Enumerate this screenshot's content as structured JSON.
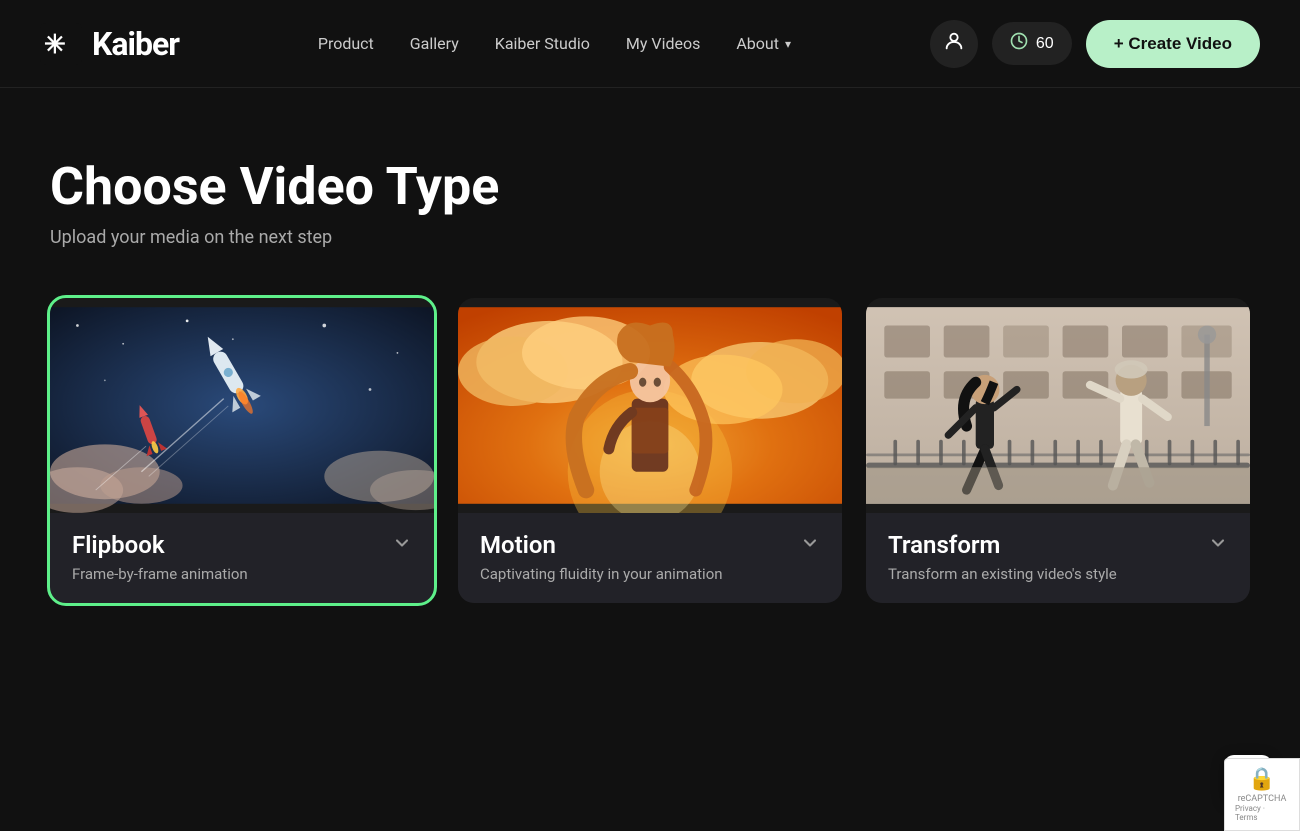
{
  "nav": {
    "logo_text": "Kaiber",
    "links": [
      {
        "id": "product",
        "label": "Product",
        "href": "#"
      },
      {
        "id": "gallery",
        "label": "Gallery",
        "href": "#"
      },
      {
        "id": "studio",
        "label": "Kaiber Studio",
        "href": "#"
      },
      {
        "id": "my_videos",
        "label": "My Videos",
        "href": "#"
      },
      {
        "id": "about",
        "label": "About",
        "href": "#",
        "has_dropdown": true
      }
    ],
    "credits_count": "60",
    "create_button_label": "+ Create Video"
  },
  "main": {
    "page_title": "Choose Video Type",
    "page_subtitle": "Upload your media on the next step",
    "cards": [
      {
        "id": "flipbook",
        "title": "Flipbook",
        "description": "Frame-by-frame animation",
        "selected": true
      },
      {
        "id": "motion",
        "title": "Motion",
        "description": "Captivating fluidity in your animation",
        "selected": false
      },
      {
        "id": "transform",
        "title": "Transform",
        "description": "Transform an existing video's style",
        "selected": false
      }
    ]
  }
}
